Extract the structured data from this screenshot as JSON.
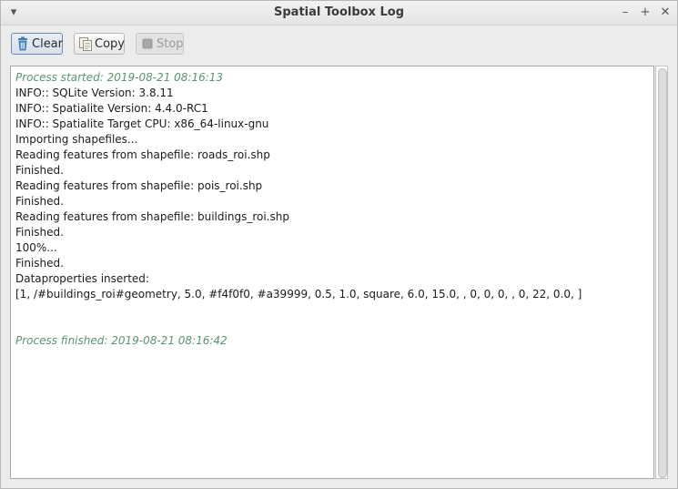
{
  "window": {
    "title": "Spatial Toolbox Log",
    "menu_glyph": "▾",
    "minimize_glyph": "–",
    "maximize_glyph": "+",
    "close_glyph": "✕"
  },
  "toolbar": {
    "clear_label": "Clear",
    "copy_label": "Copy",
    "stop_label": "Stop"
  },
  "log": {
    "lines": [
      {
        "text": "Process started: 2019-08-21 08:16:13",
        "style": "green"
      },
      {
        "text": "INFO:: SQLite Version: 3.8.11",
        "style": ""
      },
      {
        "text": "INFO:: Spatialite Version: 4.4.0-RC1",
        "style": ""
      },
      {
        "text": "INFO:: Spatialite Target CPU: x86_64-linux-gnu",
        "style": ""
      },
      {
        "text": "Importing shapefiles...",
        "style": ""
      },
      {
        "text": "Reading features from shapefile: roads_roi.shp",
        "style": ""
      },
      {
        "text": "Finished.",
        "style": ""
      },
      {
        "text": "Reading features from shapefile: pois_roi.shp",
        "style": ""
      },
      {
        "text": "Finished.",
        "style": ""
      },
      {
        "text": "Reading features from shapefile: buildings_roi.shp",
        "style": ""
      },
      {
        "text": "Finished.",
        "style": ""
      },
      {
        "text": "100%...",
        "style": ""
      },
      {
        "text": "Finished.",
        "style": ""
      },
      {
        "text": "Dataproperties inserted:",
        "style": ""
      },
      {
        "text": "[1, /#buildings_roi#geometry, 5.0, #f4f0f0, #a39999, 0.5, 1.0, square, 6.0, 15.0, , 0, 0, 0, , 0, 22, 0.0, ]",
        "style": ""
      },
      {
        "text": "",
        "style": ""
      },
      {
        "text": "",
        "style": ""
      },
      {
        "text": "Process finished: 2019-08-21 08:16:42",
        "style": "green"
      }
    ]
  },
  "colors": {
    "status_text": "#5a9470"
  }
}
